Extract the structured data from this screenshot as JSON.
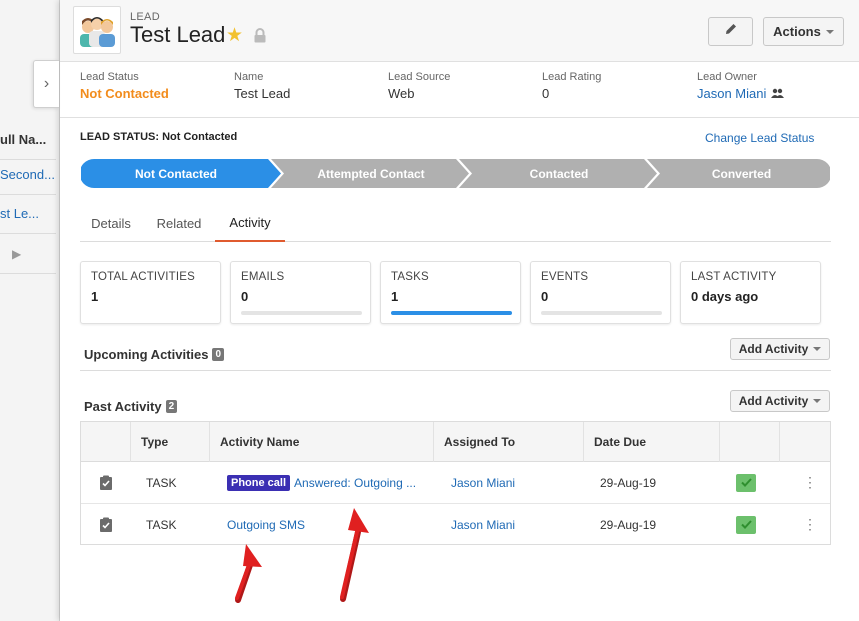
{
  "background_list": {
    "header": "ull Na...",
    "rows": [
      "Second...",
      "st Le..."
    ]
  },
  "record": {
    "type_label": "LEAD",
    "title": "Test Lead",
    "actions_label": "Actions"
  },
  "highlights": [
    {
      "label": "Lead Status",
      "value": "Not Contacted"
    },
    {
      "label": "Name",
      "value": "Test Lead"
    },
    {
      "label": "Lead Source",
      "value": "Web"
    },
    {
      "label": "Lead Rating",
      "value": "0"
    },
    {
      "label": "Lead Owner",
      "value": "Jason Miani"
    }
  ],
  "lead_status": {
    "label": "LEAD STATUS:",
    "value": "Not Contacted",
    "change_link": "Change Lead Status",
    "steps": [
      "Not Contacted",
      "Attempted Contact",
      "Contacted",
      "Converted"
    ],
    "active_color": "#2b8fe6",
    "inactive_color": "#b0b0b0"
  },
  "tabs": [
    "Details",
    "Related",
    "Activity"
  ],
  "summary_cards": [
    {
      "label": "TOTAL ACTIVITIES",
      "value": "1"
    },
    {
      "label": "EMAILS",
      "value": "0",
      "progress": 0
    },
    {
      "label": "TASKS",
      "value": "1",
      "progress": 1
    },
    {
      "label": "EVENTS",
      "value": "0",
      "progress": 0
    },
    {
      "label": "LAST ACTIVITY",
      "value": "0 days ago"
    }
  ],
  "upcoming": {
    "title": "Upcoming Activities",
    "count": "0",
    "add_label": "Add Activity"
  },
  "past": {
    "title": "Past Activity",
    "count": "2",
    "add_label": "Add Activity"
  },
  "table": {
    "columns": [
      "Type",
      "Activity Name",
      "Assigned To",
      "Date Due"
    ],
    "rows": [
      {
        "type": "TASK",
        "badge": "Phone call",
        "name": "Answered: Outgoing ...",
        "assigned": "Jason Miani",
        "due": "29-Aug-19"
      },
      {
        "type": "TASK",
        "badge": "",
        "name": "Outgoing SMS",
        "assigned": "Jason Miani",
        "due": "29-Aug-19"
      }
    ]
  },
  "colors": {
    "accent": "#1f6ab5",
    "status_orange": "#f28c1c",
    "tab_underline": "#e05b2f",
    "annotation_arrow": "#e02020"
  }
}
